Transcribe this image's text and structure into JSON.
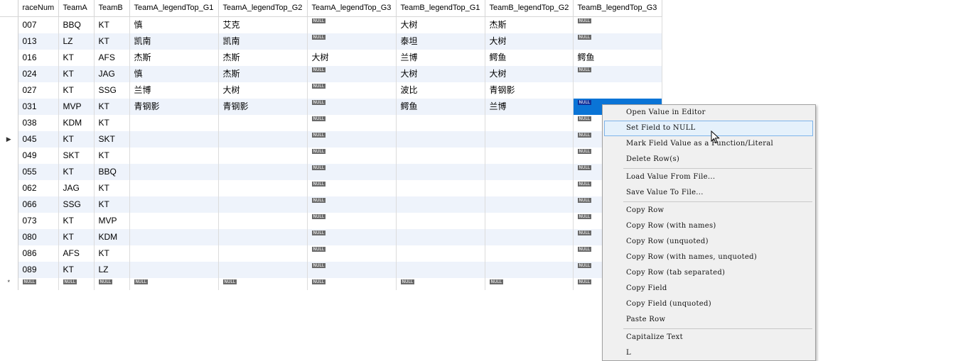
{
  "grid": {
    "columns": [
      "raceNum",
      "TeamA",
      "TeamB",
      "TeamA_legendTop_G1",
      "TeamA_legendTop_G2",
      "TeamA_legendTop_G3",
      "TeamB_legendTop_G1",
      "TeamB_legendTop_G2",
      "TeamB_legendTop_G3"
    ],
    "null_label": "NULL",
    "new_row_marker": "*",
    "current_row_marker": "▶",
    "rows": [
      [
        "007",
        "BBQ",
        "KT",
        "慎",
        "艾克",
        null,
        "大树",
        "杰斯",
        null
      ],
      [
        "013",
        "LZ",
        "KT",
        "凯南",
        "凯南",
        null,
        "泰坦",
        "大树",
        null
      ],
      [
        "016",
        "KT",
        "AFS",
        "杰斯",
        "杰斯",
        "大树",
        "兰博",
        "鳄鱼",
        "鳄鱼"
      ],
      [
        "024",
        "KT",
        "JAG",
        "慎",
        "杰斯",
        null,
        "大树",
        "大树",
        null
      ],
      [
        "027",
        "KT",
        "SSG",
        "兰博",
        "大树",
        null,
        "波比",
        "青钢影",
        ""
      ],
      [
        "031",
        "MVP",
        "KT",
        "青钢影",
        "青钢影",
        null,
        "鳄鱼",
        "兰博",
        null
      ],
      [
        "038",
        "KDM",
        "KT",
        "",
        "",
        null,
        "",
        "",
        null
      ],
      [
        "045",
        "KT",
        "SKT",
        "",
        "",
        null,
        "",
        "",
        null
      ],
      [
        "049",
        "SKT",
        "KT",
        "",
        "",
        null,
        "",
        "",
        null
      ],
      [
        "055",
        "KT",
        "BBQ",
        "",
        "",
        null,
        "",
        "",
        null
      ],
      [
        "062",
        "JAG",
        "KT",
        "",
        "",
        null,
        "",
        "",
        null
      ],
      [
        "066",
        "SSG",
        "KT",
        "",
        "",
        null,
        "",
        "",
        null
      ],
      [
        "073",
        "KT",
        "MVP",
        "",
        "",
        null,
        "",
        "",
        null
      ],
      [
        "080",
        "KT",
        "KDM",
        "",
        "",
        null,
        "",
        "",
        null
      ],
      [
        "086",
        "AFS",
        "KT",
        "",
        "",
        null,
        "",
        "",
        null
      ],
      [
        "089",
        "KT",
        "LZ",
        "",
        "",
        null,
        "",
        "",
        null
      ]
    ]
  },
  "context_menu": {
    "items": [
      {
        "label": "Open Value in Editor",
        "name": "menu-open-value-in-editor"
      },
      {
        "label": "Set Field to NULL",
        "name": "menu-set-field-to-null",
        "highlighted": true
      },
      {
        "label": "Mark Field Value as a Function/Literal",
        "name": "menu-mark-field-value-function-literal"
      },
      {
        "label": "Delete Row(s)",
        "name": "menu-delete-rows"
      },
      {
        "separator": true
      },
      {
        "label": "Load Value From File...",
        "name": "menu-load-value-from-file"
      },
      {
        "label": "Save Value To File...",
        "name": "menu-save-value-to-file"
      },
      {
        "separator": true
      },
      {
        "label": "Copy Row",
        "name": "menu-copy-row"
      },
      {
        "label": "Copy Row (with names)",
        "name": "menu-copy-row-with-names"
      },
      {
        "label": "Copy Row (unquoted)",
        "name": "menu-copy-row-unquoted"
      },
      {
        "label": "Copy Row (with names, unquoted)",
        "name": "menu-copy-row-with-names-unquoted"
      },
      {
        "label": "Copy Row (tab separated)",
        "name": "menu-copy-row-tab-separated"
      },
      {
        "label": "Copy Field",
        "name": "menu-copy-field"
      },
      {
        "label": "Copy Field (unquoted)",
        "name": "menu-copy-field-unquoted"
      },
      {
        "label": "Paste Row",
        "name": "menu-paste-row"
      },
      {
        "separator": true
      },
      {
        "label": "Capitalize Text",
        "name": "menu-capitalize-text"
      },
      {
        "label": "L",
        "name": "menu-lowercase-text"
      }
    ]
  },
  "colors": {
    "row_alt": "#eef3fb",
    "selection": "#0a74d6",
    "menu_hover": "#e5f1fb"
  }
}
